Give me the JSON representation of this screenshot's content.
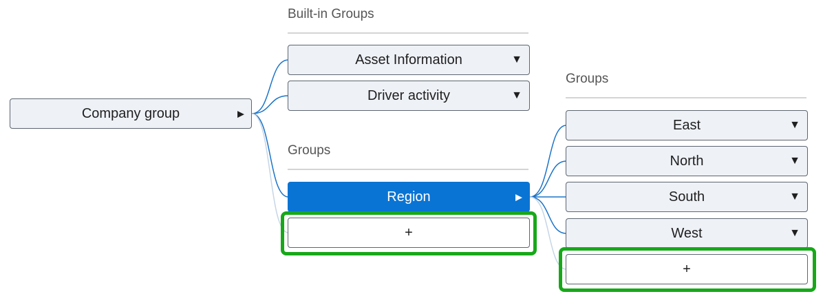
{
  "root": {
    "label": "Company group",
    "caret": "▶"
  },
  "builtin_section": {
    "title": "Built-in Groups",
    "items": [
      {
        "label": "Asset Information",
        "caret": "▼"
      },
      {
        "label": "Driver activity",
        "caret": "▼"
      }
    ]
  },
  "groups_section": {
    "title": "Groups",
    "selected": {
      "label": "Region",
      "caret": "▶"
    },
    "add_label": "+"
  },
  "region_section": {
    "title": "Groups",
    "items": [
      {
        "label": "East",
        "caret": "▼"
      },
      {
        "label": "North",
        "caret": "▼"
      },
      {
        "label": "South",
        "caret": "▼"
      },
      {
        "label": "West",
        "caret": "▼"
      }
    ],
    "add_label": "+"
  },
  "colors": {
    "selected_bg": "#0a74d4",
    "connector": "#1a73c8",
    "connector_faint": "#c5d5e6",
    "highlight": "#17a81a"
  }
}
